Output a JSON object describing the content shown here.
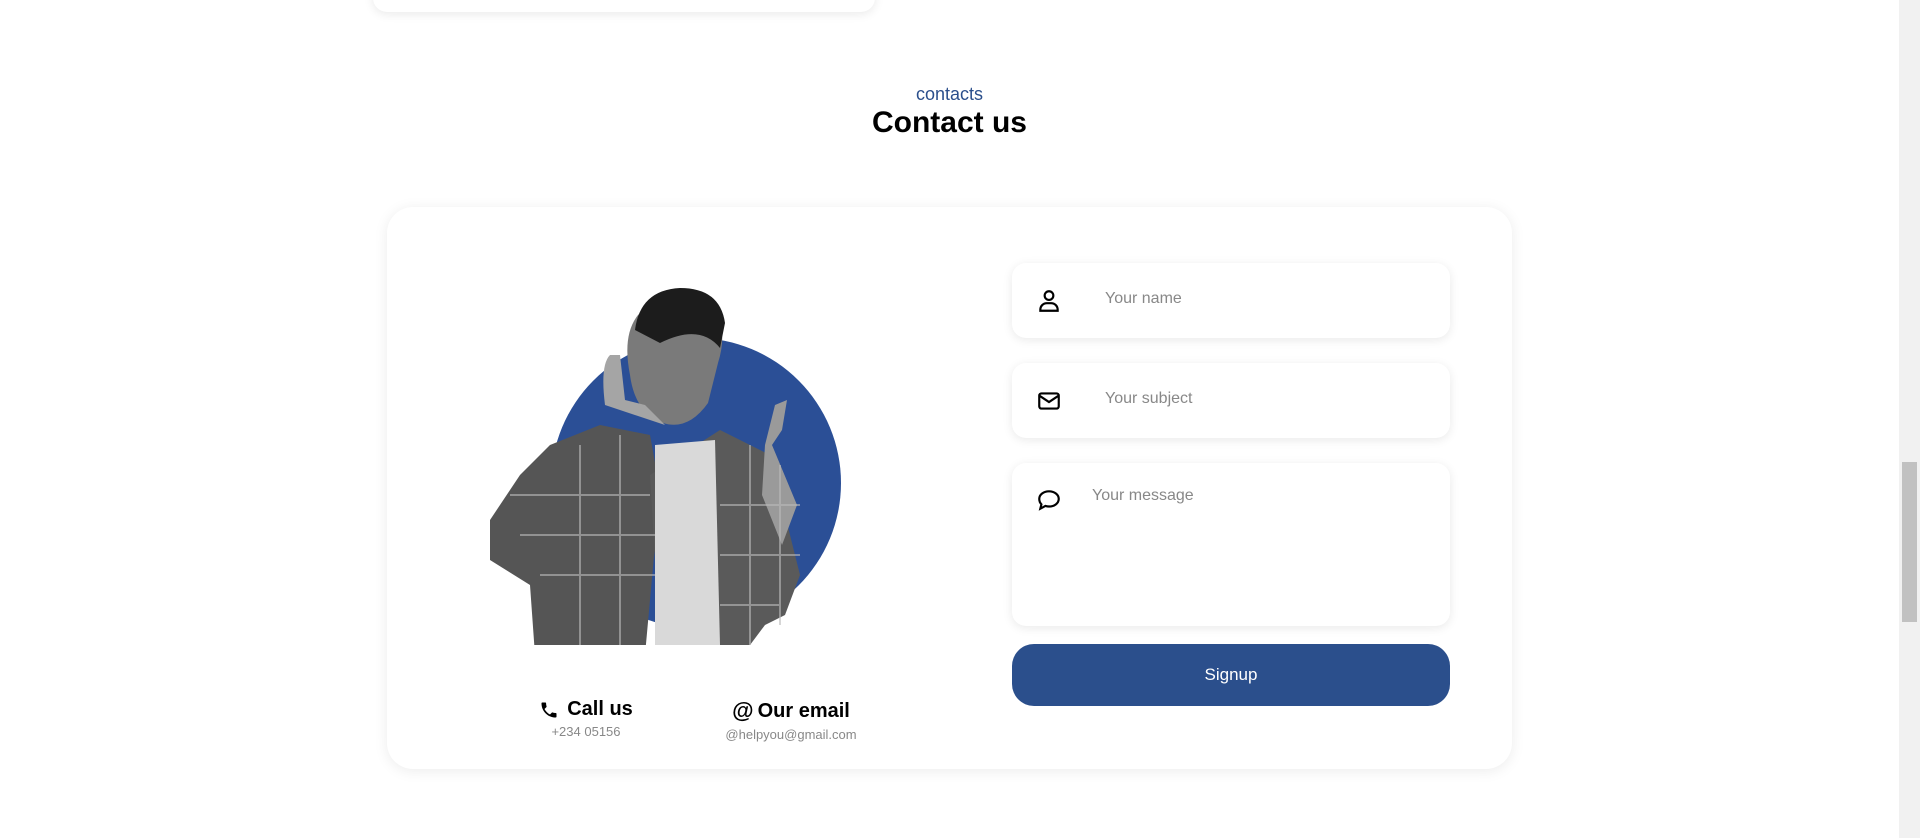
{
  "section": {
    "eyebrow": "contacts",
    "title": "Contact us"
  },
  "contact_info": [
    {
      "icon": "phone-icon",
      "label": "Call us",
      "value": "+234 05156"
    },
    {
      "icon": "at-icon",
      "label": "Our email",
      "value": "@helpyou@gmail.com"
    }
  ],
  "form": {
    "name_placeholder": "Your name",
    "subject_placeholder": "Your subject",
    "message_placeholder": "Your message",
    "submit_label": "Signup"
  },
  "colors": {
    "accent": "#2b4f8c",
    "circle": "#2b4f96"
  }
}
